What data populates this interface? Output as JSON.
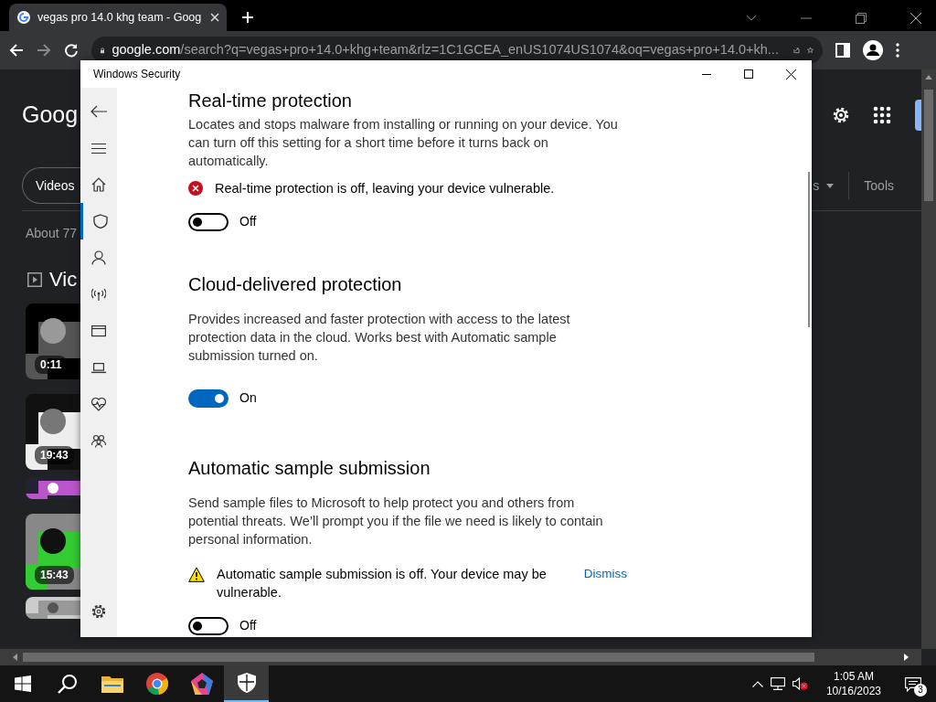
{
  "browser": {
    "tab_title": "vegas pro 14.0 khg team - Goog",
    "url_host": "google.com",
    "url_path": "/search?q=vegas+pro+14.0+khg+team&rlz=1C1GCEA_enUS1074US1074&oq=vegas+pro+14.0+kh..."
  },
  "google_page": {
    "logo": "Goog",
    "filter_chip": "Videos",
    "results_count": "About 77",
    "section_title": "Vic",
    "cut_label": "s",
    "tools": "Tools",
    "videos": [
      {
        "kind": "picture",
        "duration": "0:11"
      },
      {
        "kind": "picture",
        "duration": "19:43"
      },
      {
        "kind": "picture"
      },
      {
        "kind": "picture",
        "duration": "15:43"
      },
      {
        "kind": "picture"
      }
    ]
  },
  "security_window": {
    "title": "Windows Security",
    "nav": [
      {
        "kind": "home",
        "selected": false
      },
      {
        "kind": "shield",
        "selected": true
      },
      {
        "kind": "account",
        "selected": false
      },
      {
        "kind": "network",
        "selected": false
      },
      {
        "kind": "app",
        "selected": false
      },
      {
        "kind": "device",
        "selected": false
      },
      {
        "kind": "health",
        "selected": false
      },
      {
        "kind": "family",
        "selected": false
      }
    ],
    "sections": [
      {
        "heading": "Real-time protection",
        "description": "Locates and stops malware from installing or running on your device. You can turn off this setting for a short time before it turns back on automatically.",
        "alert": {
          "kind": "error",
          "text": "Real-time protection is off, leaving your device vulnerable."
        },
        "toggle": {
          "on": false,
          "label": "Off"
        }
      },
      {
        "heading": "Cloud-delivered protection",
        "description": "Provides increased and faster protection with access to the latest protection data in the cloud. Works best with Automatic sample submission turned on.",
        "toggle": {
          "on": true,
          "label": "On"
        }
      },
      {
        "heading": "Automatic sample submission",
        "description": "Send sample files to Microsoft to help protect you and others from potential threats. We’ll prompt you if the file we need is likely to contain personal information.",
        "alert": {
          "kind": "warning",
          "text": "Automatic sample submission is off. Your device may be vulnerable.",
          "action": "Dismiss"
        },
        "toggle": {
          "on": false,
          "label": "Off"
        }
      }
    ]
  },
  "taskbar": {
    "apps": [
      {
        "kind": "search",
        "selected": false
      },
      {
        "kind": "folder",
        "selected": false
      },
      {
        "kind": "chrome",
        "selected": false
      },
      {
        "kind": "pentagon",
        "selected": false
      },
      {
        "kind": "shield",
        "selected": true
      }
    ],
    "time": "1:05 AM",
    "date": "10/16/2023",
    "notifications": "3"
  }
}
